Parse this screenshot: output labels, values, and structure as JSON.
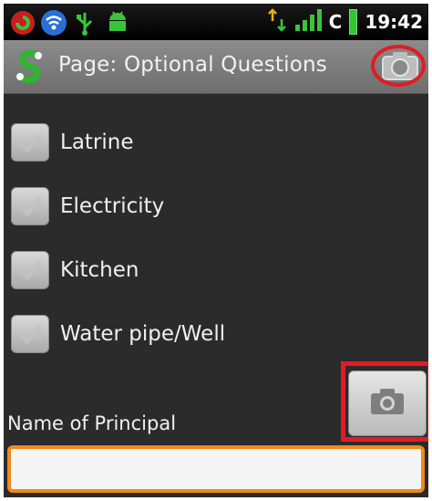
{
  "status_bar": {
    "network_type": "C",
    "time": "19:42",
    "icons": [
      "app-notification-icon",
      "wifi-icon",
      "usb-icon",
      "android-debug-icon",
      "data-transfer-icon",
      "signal-icon",
      "battery-icon"
    ]
  },
  "header": {
    "title": "Page: Optional Questions",
    "camera_icon": "camera-icon"
  },
  "checkboxes": [
    {
      "label": "Latrine",
      "checked": true
    },
    {
      "label": "Electricity",
      "checked": true
    },
    {
      "label": "Kitchen",
      "checked": true
    },
    {
      "label": "Water pipe/Well",
      "checked": true
    }
  ],
  "field": {
    "label": "Name of Principal",
    "value": "",
    "placeholder": ""
  },
  "colors": {
    "highlight": "#e01c24",
    "input_focus": "#f08a1c",
    "background": "#2b2b2b",
    "battery": "#33c633"
  }
}
